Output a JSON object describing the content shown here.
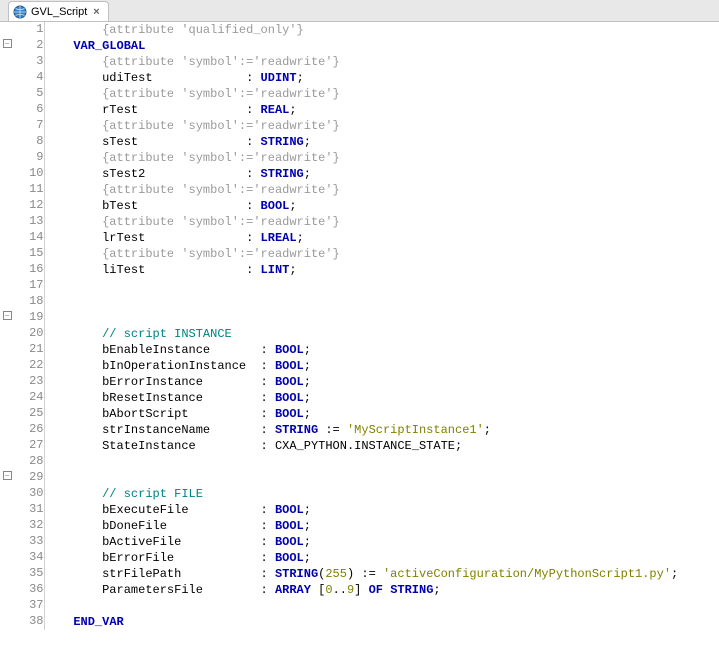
{
  "tab": {
    "title": "GVL_Script"
  },
  "lines": [
    {
      "n": 1,
      "fold": "",
      "tokens": [
        [
          "plain",
          "        "
        ],
        [
          "attr",
          "{attribute 'qualified_only'}"
        ]
      ]
    },
    {
      "n": 2,
      "fold": "box",
      "tokens": [
        [
          "plain",
          "    "
        ],
        [
          "kw",
          "VAR_GLOBAL"
        ]
      ]
    },
    {
      "n": 3,
      "fold": "",
      "tokens": [
        [
          "plain",
          "        "
        ],
        [
          "attr",
          "{attribute 'symbol':='readwrite'}"
        ]
      ]
    },
    {
      "n": 4,
      "fold": "",
      "tokens": [
        [
          "plain",
          "        udiTest             : "
        ],
        [
          "type",
          "UDINT"
        ],
        [
          "plain",
          ";"
        ]
      ]
    },
    {
      "n": 5,
      "fold": "",
      "tokens": [
        [
          "plain",
          "        "
        ],
        [
          "attr",
          "{attribute 'symbol':='readwrite'}"
        ]
      ]
    },
    {
      "n": 6,
      "fold": "",
      "tokens": [
        [
          "plain",
          "        rTest               : "
        ],
        [
          "type",
          "REAL"
        ],
        [
          "plain",
          ";"
        ]
      ]
    },
    {
      "n": 7,
      "fold": "",
      "tokens": [
        [
          "plain",
          "        "
        ],
        [
          "attr",
          "{attribute 'symbol':='readwrite'}"
        ]
      ]
    },
    {
      "n": 8,
      "fold": "",
      "tokens": [
        [
          "plain",
          "        sTest               : "
        ],
        [
          "type",
          "STRING"
        ],
        [
          "plain",
          ";"
        ]
      ]
    },
    {
      "n": 9,
      "fold": "",
      "tokens": [
        [
          "plain",
          "        "
        ],
        [
          "attr",
          "{attribute 'symbol':='readwrite'}"
        ]
      ]
    },
    {
      "n": 10,
      "fold": "",
      "tokens": [
        [
          "plain",
          "        sTest2              : "
        ],
        [
          "type",
          "STRING"
        ],
        [
          "plain",
          ";"
        ]
      ]
    },
    {
      "n": 11,
      "fold": "",
      "tokens": [
        [
          "plain",
          "        "
        ],
        [
          "attr",
          "{attribute 'symbol':='readwrite'}"
        ]
      ]
    },
    {
      "n": 12,
      "fold": "",
      "tokens": [
        [
          "plain",
          "        bTest               : "
        ],
        [
          "type",
          "BOOL"
        ],
        [
          "plain",
          ";"
        ]
      ]
    },
    {
      "n": 13,
      "fold": "",
      "tokens": [
        [
          "plain",
          "        "
        ],
        [
          "attr",
          "{attribute 'symbol':='readwrite'}"
        ]
      ]
    },
    {
      "n": 14,
      "fold": "",
      "tokens": [
        [
          "plain",
          "        lrTest              : "
        ],
        [
          "type",
          "LREAL"
        ],
        [
          "plain",
          ";"
        ]
      ]
    },
    {
      "n": 15,
      "fold": "",
      "tokens": [
        [
          "plain",
          "        "
        ],
        [
          "attr",
          "{attribute 'symbol':='readwrite'}"
        ]
      ]
    },
    {
      "n": 16,
      "fold": "",
      "tokens": [
        [
          "plain",
          "        liTest              : "
        ],
        [
          "type",
          "LINT"
        ],
        [
          "plain",
          ";"
        ]
      ]
    },
    {
      "n": 17,
      "fold": "",
      "tokens": [
        [
          "plain",
          ""
        ]
      ]
    },
    {
      "n": 18,
      "fold": "",
      "tokens": [
        [
          "plain",
          ""
        ]
      ]
    },
    {
      "n": 19,
      "fold": "box",
      "tokens": [
        [
          "plain",
          ""
        ]
      ]
    },
    {
      "n": 20,
      "fold": "",
      "tokens": [
        [
          "plain",
          "        "
        ],
        [
          "comment",
          "// script INSTANCE"
        ]
      ]
    },
    {
      "n": 21,
      "fold": "",
      "tokens": [
        [
          "plain",
          "        bEnableInstance       : "
        ],
        [
          "type",
          "BOOL"
        ],
        [
          "plain",
          ";"
        ]
      ]
    },
    {
      "n": 22,
      "fold": "",
      "tokens": [
        [
          "plain",
          "        bInOperationInstance  : "
        ],
        [
          "type",
          "BOOL"
        ],
        [
          "plain",
          ";"
        ]
      ]
    },
    {
      "n": 23,
      "fold": "",
      "tokens": [
        [
          "plain",
          "        bErrorInstance        : "
        ],
        [
          "type",
          "BOOL"
        ],
        [
          "plain",
          ";"
        ]
      ]
    },
    {
      "n": 24,
      "fold": "",
      "tokens": [
        [
          "plain",
          "        bResetInstance        : "
        ],
        [
          "type",
          "BOOL"
        ],
        [
          "plain",
          ";"
        ]
      ]
    },
    {
      "n": 25,
      "fold": "",
      "tokens": [
        [
          "plain",
          "        bAbortScript          : "
        ],
        [
          "type",
          "BOOL"
        ],
        [
          "plain",
          ";"
        ]
      ]
    },
    {
      "n": 26,
      "fold": "",
      "tokens": [
        [
          "plain",
          "        strInstanceName       : "
        ],
        [
          "type",
          "STRING"
        ],
        [
          "plain",
          " := "
        ],
        [
          "str",
          "'MyScriptInstance1'"
        ],
        [
          "plain",
          ";"
        ]
      ]
    },
    {
      "n": 27,
      "fold": "",
      "tokens": [
        [
          "plain",
          "        StateInstance         : CXA_PYTHON.INSTANCE_STATE;"
        ]
      ]
    },
    {
      "n": 28,
      "fold": "",
      "tokens": [
        [
          "plain",
          ""
        ]
      ]
    },
    {
      "n": 29,
      "fold": "box",
      "tokens": [
        [
          "plain",
          ""
        ]
      ]
    },
    {
      "n": 30,
      "fold": "",
      "tokens": [
        [
          "plain",
          "        "
        ],
        [
          "comment",
          "// script FILE"
        ]
      ]
    },
    {
      "n": 31,
      "fold": "",
      "tokens": [
        [
          "plain",
          "        bExecuteFile          : "
        ],
        [
          "type",
          "BOOL"
        ],
        [
          "plain",
          ";"
        ]
      ]
    },
    {
      "n": 32,
      "fold": "",
      "tokens": [
        [
          "plain",
          "        bDoneFile             : "
        ],
        [
          "type",
          "BOOL"
        ],
        [
          "plain",
          ";"
        ]
      ]
    },
    {
      "n": 33,
      "fold": "",
      "tokens": [
        [
          "plain",
          "        bActiveFile           : "
        ],
        [
          "type",
          "BOOL"
        ],
        [
          "plain",
          ";"
        ]
      ]
    },
    {
      "n": 34,
      "fold": "",
      "tokens": [
        [
          "plain",
          "        bErrorFile            : "
        ],
        [
          "type",
          "BOOL"
        ],
        [
          "plain",
          ";"
        ]
      ]
    },
    {
      "n": 35,
      "fold": "",
      "tokens": [
        [
          "plain",
          "        strFilePath           : "
        ],
        [
          "type",
          "STRING"
        ],
        [
          "plain",
          "("
        ],
        [
          "num",
          "255"
        ],
        [
          "plain",
          ") := "
        ],
        [
          "str",
          "'activeConfiguration/MyPythonScript1.py'"
        ],
        [
          "plain",
          ";"
        ]
      ]
    },
    {
      "n": 36,
      "fold": "",
      "tokens": [
        [
          "plain",
          "        ParametersFile        : "
        ],
        [
          "type",
          "ARRAY"
        ],
        [
          "plain",
          " ["
        ],
        [
          "num",
          "0"
        ],
        [
          "plain",
          ".."
        ],
        [
          "num",
          "9"
        ],
        [
          "plain",
          "] "
        ],
        [
          "kw",
          "OF"
        ],
        [
          "plain",
          " "
        ],
        [
          "type",
          "STRING"
        ],
        [
          "plain",
          ";"
        ]
      ]
    },
    {
      "n": 37,
      "fold": "",
      "tokens": [
        [
          "plain",
          ""
        ]
      ]
    },
    {
      "n": 38,
      "fold": "",
      "tokens": [
        [
          "plain",
          "    "
        ],
        [
          "kw",
          "END_VAR"
        ]
      ]
    }
  ]
}
